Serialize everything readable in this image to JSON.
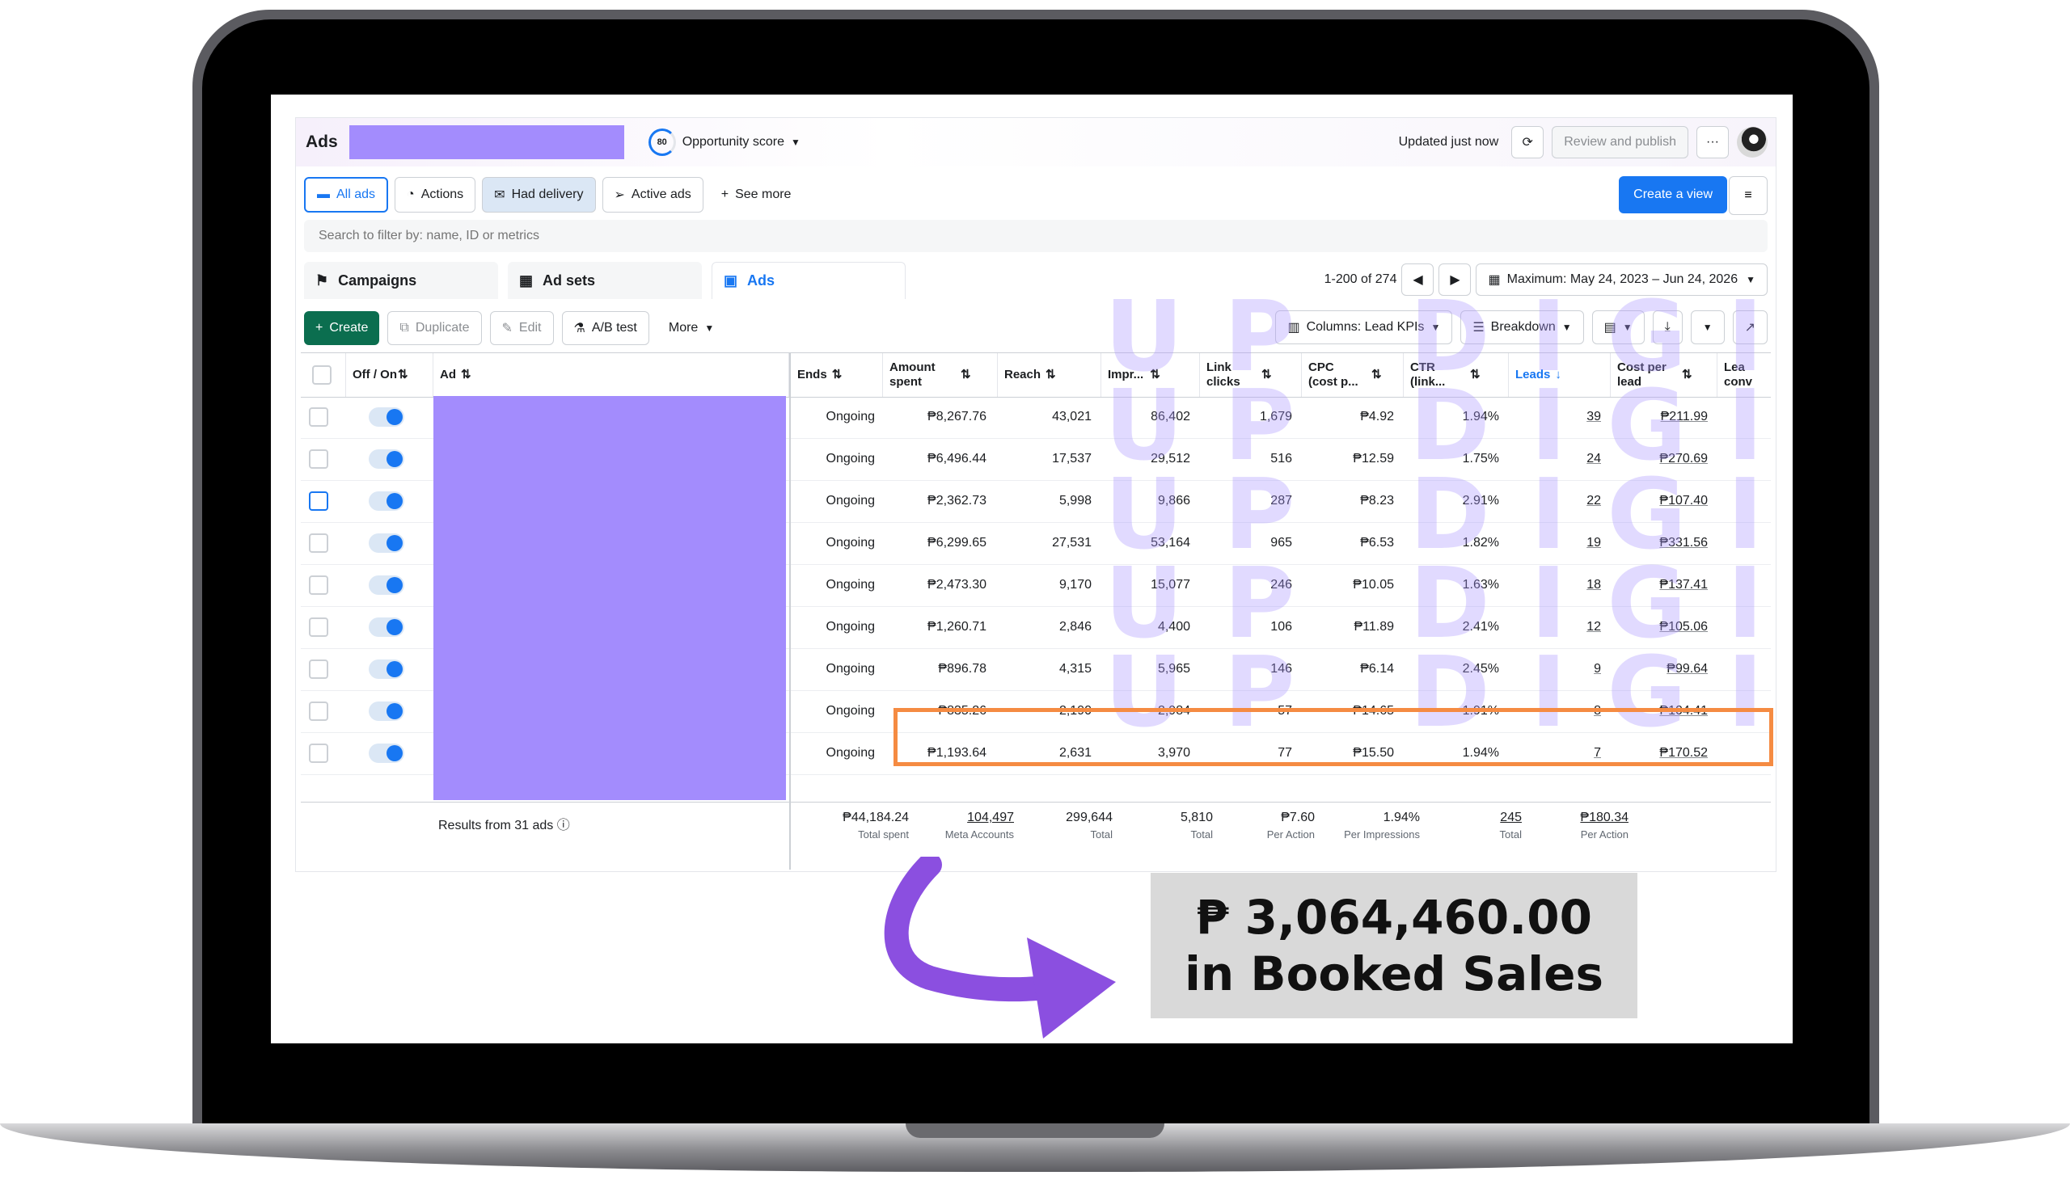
{
  "header": {
    "title": "Ads",
    "score": "80",
    "score_label": "Opportunity score",
    "updated": "Updated just now",
    "review_publish": "Review and publish"
  },
  "tabs": {
    "all_ads": "All ads",
    "actions": "Actions",
    "had_delivery": "Had delivery",
    "active_ads": "Active ads",
    "see_more": "See more",
    "create_view": "Create a view"
  },
  "search": {
    "placeholder": "Search to filter by: name, ID or metrics"
  },
  "levels": {
    "campaigns": "Campaigns",
    "ad_sets": "Ad sets",
    "ads": "Ads"
  },
  "pager": {
    "range": "1-200 of 274",
    "date_range": "Maximum: May 24, 2023 – Jun 24, 2026"
  },
  "toolbar": {
    "create": "Create",
    "duplicate": "Duplicate",
    "edit": "Edit",
    "ab_test": "A/B test",
    "more": "More",
    "columns": "Columns: Lead KPIs",
    "breakdown": "Breakdown"
  },
  "columns": {
    "off_on": "Off / On",
    "ad": "Ad",
    "ends": "Ends",
    "amount_spent": "Amount spent",
    "reach": "Reach",
    "impressions": "Impr...",
    "link_clicks": "Link clicks",
    "cpc": "CPC (cost p...",
    "ctr": "CTR (link...",
    "leads": "Leads",
    "cost_per_lead": "Cost per lead",
    "lead_conv": "Lea conv"
  },
  "rows": [
    {
      "ends": "Ongoing",
      "spent": "₱8,267.76",
      "reach": "43,021",
      "impr": "86,402",
      "clicks": "1,679",
      "cpc": "₱4.92",
      "ctr": "1.94%",
      "leads": "39",
      "cpl": "₱211.99"
    },
    {
      "ends": "Ongoing",
      "spent": "₱6,496.44",
      "reach": "17,537",
      "impr": "29,512",
      "clicks": "516",
      "cpc": "₱12.59",
      "ctr": "1.75%",
      "leads": "24",
      "cpl": "₱270.69"
    },
    {
      "ends": "Ongoing",
      "spent": "₱2,362.73",
      "reach": "5,998",
      "impr": "9,866",
      "clicks": "287",
      "cpc": "₱8.23",
      "ctr": "2.91%",
      "leads": "22",
      "cpl": "₱107.40"
    },
    {
      "ends": "Ongoing",
      "spent": "₱6,299.65",
      "reach": "27,531",
      "impr": "53,164",
      "clicks": "965",
      "cpc": "₱6.53",
      "ctr": "1.82%",
      "leads": "19",
      "cpl": "₱331.56"
    },
    {
      "ends": "Ongoing",
      "spent": "₱2,473.30",
      "reach": "9,170",
      "impr": "15,077",
      "clicks": "246",
      "cpc": "₱10.05",
      "ctr": "1.63%",
      "leads": "18",
      "cpl": "₱137.41"
    },
    {
      "ends": "Ongoing",
      "spent": "₱1,260.71",
      "reach": "2,846",
      "impr": "4,400",
      "clicks": "106",
      "cpc": "₱11.89",
      "ctr": "2.41%",
      "leads": "12",
      "cpl": "₱105.06"
    },
    {
      "ends": "Ongoing",
      "spent": "₱896.78",
      "reach": "4,315",
      "impr": "5,965",
      "clicks": "146",
      "cpc": "₱6.14",
      "ctr": "2.45%",
      "leads": "9",
      "cpl": "₱99.64"
    },
    {
      "ends": "Ongoing",
      "spent": "₱835.26",
      "reach": "2,190",
      "impr": "2,984",
      "clicks": "57",
      "cpc": "₱14.65",
      "ctr": "1.91%",
      "leads": "8",
      "cpl": "₱104.41"
    },
    {
      "ends": "Ongoing",
      "spent": "₱1,193.64",
      "reach": "2,631",
      "impr": "3,970",
      "clicks": "77",
      "cpc": "₱15.50",
      "ctr": "1.94%",
      "leads": "7",
      "cpl": "₱170.52"
    }
  ],
  "summary": {
    "label": "Results from 31 ads",
    "spent": "₱44,184.24",
    "spent_cap": "Total spent",
    "reach": "104,497",
    "reach_cap": "Meta Accounts",
    "impr": "299,644",
    "impr_cap": "Total",
    "clicks": "5,810",
    "clicks_cap": "Total",
    "cpc": "₱7.60",
    "cpc_cap": "Per Action",
    "ctr": "1.94%",
    "ctr_cap": "Per Impressions",
    "leads": "245",
    "leads_cap": "Total",
    "cpl": "₱180.34",
    "cpl_cap": "Per Action"
  },
  "watermark": "UP DIGITAL",
  "callout": {
    "line1": "₱ 3,064,460.00",
    "line2": "in Booked Sales"
  },
  "colors": {
    "accent": "#1877f2",
    "redaction": "#a38cfd",
    "highlight": "#f58b42",
    "create_green": "#0b6e4f",
    "arrow": "#8b4fe0"
  }
}
